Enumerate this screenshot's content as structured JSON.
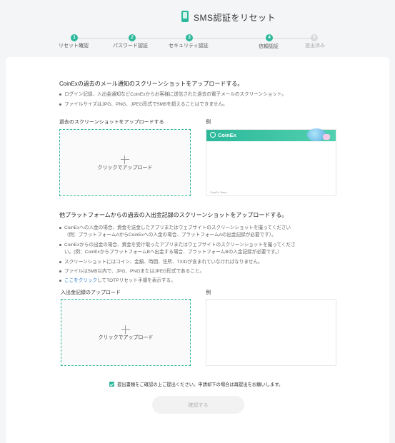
{
  "header": {
    "title": "SMS認証をリセット",
    "icon": "phone-icon"
  },
  "steps": [
    {
      "num": "1",
      "label": "リセット確認",
      "state": "done"
    },
    {
      "num": "2",
      "label": "パスワード認証",
      "state": "done"
    },
    {
      "num": "3",
      "label": "セキュリティ認証",
      "state": "done"
    },
    {
      "num": "4",
      "label": "信頼認証",
      "state": "current"
    },
    {
      "num": "5",
      "label": "提出済み",
      "state": "todo"
    }
  ],
  "section1": {
    "title": "CoinExの過去のメール通知のスクリーンショットをアップロードする。",
    "bullets": [
      "ログイン記録、入出金通知などCoinExからお客様に送信された過去の電子メールのスクリーンショット。",
      "ファイルサイズはJPG、PNG、JPEG形式で5MBを超えることはできません。"
    ],
    "upload_label": "過去のスクリーンショットをアップロードする",
    "upload_text": "クリックでアップロード",
    "example_label": "例",
    "example_brand": "CoinEx",
    "example_footer": "CoinEx Team"
  },
  "section2": {
    "title": "他プラットフォームからの過去の入出金記録のスクリーンショットをアップロードする。",
    "bullets": [
      {
        "line1": "CoinExへの入金の場合、資金を送金したアプリまたはウェブサイトのスクリーンショットを撮ってください",
        "line2": "（例：プラットフォームAからCoinExへの入金の場合、プラットフォームAの出金記録が必要です）。"
      },
      {
        "line1": "CoinExからの出金の場合、資金を受け取ったアプリまたはウェブサイトのスクリーンショットを撮ってくださ",
        "line2": "い。(例：CoinExからプラットフォームBへ出金する場合、プラットフォームBの入金記録が必要です。）"
      },
      {
        "line1": "スクリーンショットにはコイン、金額、時間、住所、TXIDが含まれていなければなりません。"
      },
      {
        "line1": "ファイルは5MB以内で、JPG、PNGまたはJPEG形式であること。"
      }
    ],
    "link_text": "ここをクリック",
    "link_suffix": "してTOTPリセット手順を表示する。",
    "upload_label": "入出金記録のアップロード",
    "upload_text": "クリックでアップロード",
    "example_label": "例"
  },
  "agree": {
    "checked": true,
    "text": "提出書類をご確認の上ご提出ください。申請却下の場合は再提出をお願いします。"
  },
  "submit": {
    "label": "確認する"
  },
  "colors": {
    "accent": "#2bb89a",
    "link": "#2b7fd1",
    "disabled_bg": "#f2f2f2",
    "disabled_text": "#b3b3b3"
  }
}
